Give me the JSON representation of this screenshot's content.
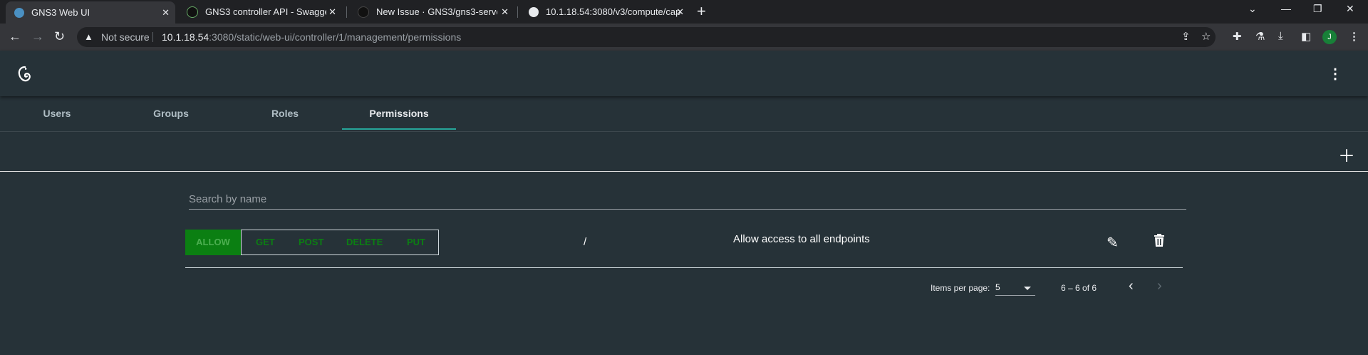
{
  "browser": {
    "tabs": [
      {
        "title": "GNS3 Web UI",
        "active": true
      },
      {
        "title": "GNS3 controller API - Swagger UI",
        "active": false
      },
      {
        "title": "New Issue · GNS3/gns3-server",
        "active": false
      },
      {
        "title": "10.1.18.54:3080/v3/compute/capabilities",
        "active": false
      }
    ],
    "security_label": "Not secure",
    "url_host": "10.1.18.54",
    "url_path": ":3080/static/web-ui/controller/1/management/permissions",
    "profile_initial": "J"
  },
  "app": {
    "nav_tabs": [
      "Users",
      "Groups",
      "Roles",
      "Permissions"
    ],
    "active_tab": "Permissions",
    "search_placeholder": "Search by name",
    "permission": {
      "action": "ALLOW",
      "methods": [
        "GET",
        "POST",
        "DELETE",
        "PUT"
      ],
      "path": "/",
      "description": "Allow access to all endpoints"
    },
    "paginator": {
      "items_per_page_label": "Items per page:",
      "items_per_page": "5",
      "range": "6 – 6 of 6"
    }
  },
  "colors": {
    "app_background": "#263238",
    "accent": "#26a69a",
    "allow_green": "#0b7f12"
  }
}
